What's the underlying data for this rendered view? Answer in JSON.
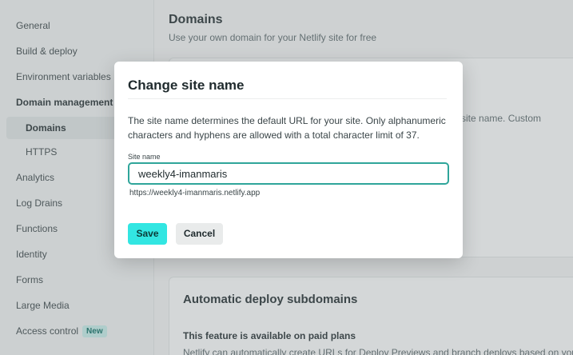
{
  "sidebar": {
    "items": [
      {
        "label": "General"
      },
      {
        "label": "Build & deploy"
      },
      {
        "label": "Environment variables"
      },
      {
        "label": "Domain management"
      },
      {
        "label": "Domains"
      },
      {
        "label": "HTTPS"
      },
      {
        "label": "Analytics"
      },
      {
        "label": "Log Drains"
      },
      {
        "label": "Functions"
      },
      {
        "label": "Identity"
      },
      {
        "label": "Forms"
      },
      {
        "label": "Large Media"
      },
      {
        "label": "Access control",
        "badge": "New"
      }
    ]
  },
  "main": {
    "title": "Domains",
    "subtitle": "Use your own domain for your Netlify site for free",
    "card_fragment": "e site name. Custom",
    "auto_title": "Automatic deploy subdomains",
    "paid_text": "This feature is available on paid plans",
    "cut_text": "Netlify can automatically create URLs for Deploy Previews and branch deploys based on your"
  },
  "modal": {
    "title": "Change site name",
    "description": "The site name determines the default URL for your site. Only alphanumeric characters and hyphens are allowed with a total character limit of 37.",
    "field_label": "Site name",
    "field_value": "weekly4-imanmaris",
    "url_hint": "https://weekly4-imanmaris.netlify.app",
    "save_label": "Save",
    "cancel_label": "Cancel"
  },
  "colors": {
    "accent": "#32e6e2",
    "input_border": "#2fa59a",
    "badge_bg": "#c9f1ec"
  }
}
